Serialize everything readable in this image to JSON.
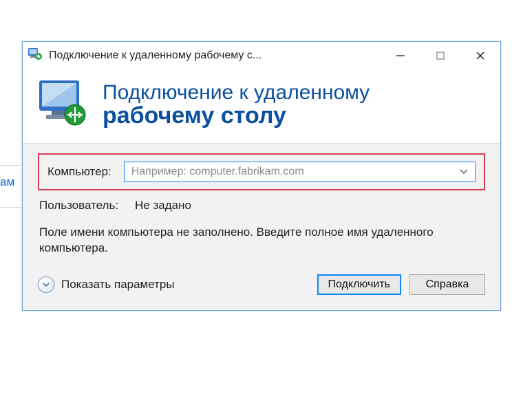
{
  "titlebar": {
    "title": "Подключение к удаленному рабочему с..."
  },
  "banner": {
    "line1": "Подключение к удаленному",
    "line2": "рабочему столу"
  },
  "form": {
    "computer_label": "Компьютер:",
    "computer_placeholder": "Например: computer.fabrikam.com",
    "user_label": "Пользователь:",
    "user_value": "Не задано",
    "hint": "Поле имени компьютера не заполнено. Введите полное имя удаленного компьютера."
  },
  "footer": {
    "expand_label": "Показать параметры",
    "connect_label": "Подключить",
    "help_label": "Справка"
  },
  "backdrop": {
    "frag": "ам"
  }
}
